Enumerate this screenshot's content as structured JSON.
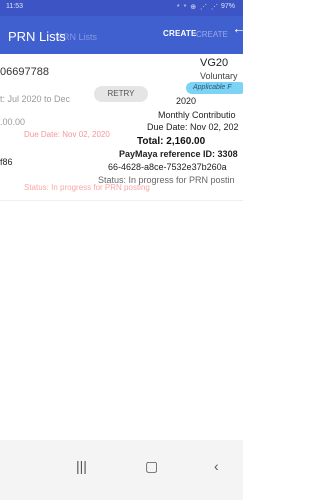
{
  "status_bar": {
    "time": "11:53",
    "icons": "* * ⊕ ⋰ ⋰",
    "battery": "97%"
  },
  "app_bar": {
    "title": "PRN Lists",
    "ghost_title": "PRN Lists",
    "create_label": "CREATE",
    "ghost_create": "CREATE",
    "back_icon": "arrow-left-icon"
  },
  "card_ghost_left": {
    "prn": "06697788",
    "applicable": "t: Jul 2020 to Dec",
    "amount": ".00.00",
    "due": "Due Date: Nov 02, 2020",
    "ref": "f86",
    "status": "Status: In progress for PRN posting"
  },
  "card_right": {
    "prn": "VG20",
    "type": "Voluntary",
    "badge": "Applicable F",
    "retry_label": "RETRY",
    "applicable_year": "2020",
    "contribution": "Monthly Contributio",
    "due_date": "Due Date: Nov 02, 202",
    "total": "Total: 2,160.00",
    "ref_label": "PayMaya reference ID: 3308",
    "ref_id": "66-4628-a8ce-7532e37b260a",
    "status": "Status: In progress for PRN postin"
  },
  "nav": {
    "recents": "recents-icon",
    "home": "home-icon",
    "back": "back-icon"
  }
}
